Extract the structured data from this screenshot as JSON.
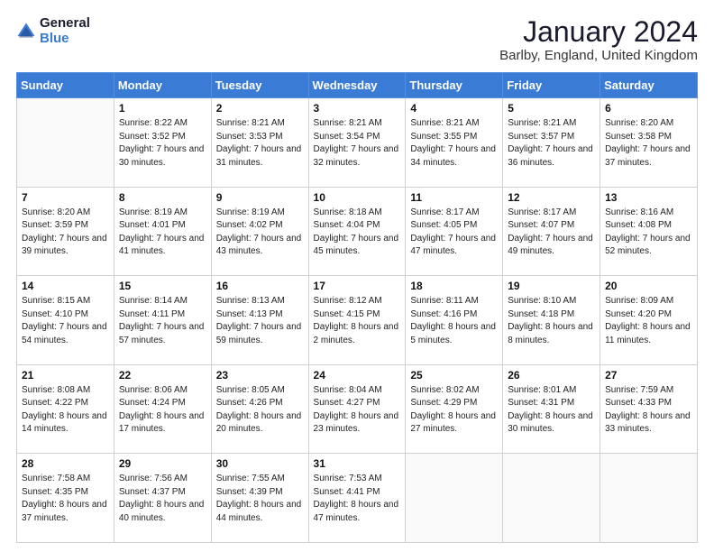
{
  "header": {
    "logo_general": "General",
    "logo_blue": "Blue",
    "month_title": "January 2024",
    "location": "Barlby, England, United Kingdom"
  },
  "days_of_week": [
    "Sunday",
    "Monday",
    "Tuesday",
    "Wednesday",
    "Thursday",
    "Friday",
    "Saturday"
  ],
  "weeks": [
    [
      {
        "date": "",
        "sunrise": "",
        "sunset": "",
        "daylight": ""
      },
      {
        "date": "1",
        "sunrise": "Sunrise: 8:22 AM",
        "sunset": "Sunset: 3:52 PM",
        "daylight": "Daylight: 7 hours and 30 minutes."
      },
      {
        "date": "2",
        "sunrise": "Sunrise: 8:21 AM",
        "sunset": "Sunset: 3:53 PM",
        "daylight": "Daylight: 7 hours and 31 minutes."
      },
      {
        "date": "3",
        "sunrise": "Sunrise: 8:21 AM",
        "sunset": "Sunset: 3:54 PM",
        "daylight": "Daylight: 7 hours and 32 minutes."
      },
      {
        "date": "4",
        "sunrise": "Sunrise: 8:21 AM",
        "sunset": "Sunset: 3:55 PM",
        "daylight": "Daylight: 7 hours and 34 minutes."
      },
      {
        "date": "5",
        "sunrise": "Sunrise: 8:21 AM",
        "sunset": "Sunset: 3:57 PM",
        "daylight": "Daylight: 7 hours and 36 minutes."
      },
      {
        "date": "6",
        "sunrise": "Sunrise: 8:20 AM",
        "sunset": "Sunset: 3:58 PM",
        "daylight": "Daylight: 7 hours and 37 minutes."
      }
    ],
    [
      {
        "date": "7",
        "sunrise": "Sunrise: 8:20 AM",
        "sunset": "Sunset: 3:59 PM",
        "daylight": "Daylight: 7 hours and 39 minutes."
      },
      {
        "date": "8",
        "sunrise": "Sunrise: 8:19 AM",
        "sunset": "Sunset: 4:01 PM",
        "daylight": "Daylight: 7 hours and 41 minutes."
      },
      {
        "date": "9",
        "sunrise": "Sunrise: 8:19 AM",
        "sunset": "Sunset: 4:02 PM",
        "daylight": "Daylight: 7 hours and 43 minutes."
      },
      {
        "date": "10",
        "sunrise": "Sunrise: 8:18 AM",
        "sunset": "Sunset: 4:04 PM",
        "daylight": "Daylight: 7 hours and 45 minutes."
      },
      {
        "date": "11",
        "sunrise": "Sunrise: 8:17 AM",
        "sunset": "Sunset: 4:05 PM",
        "daylight": "Daylight: 7 hours and 47 minutes."
      },
      {
        "date": "12",
        "sunrise": "Sunrise: 8:17 AM",
        "sunset": "Sunset: 4:07 PM",
        "daylight": "Daylight: 7 hours and 49 minutes."
      },
      {
        "date": "13",
        "sunrise": "Sunrise: 8:16 AM",
        "sunset": "Sunset: 4:08 PM",
        "daylight": "Daylight: 7 hours and 52 minutes."
      }
    ],
    [
      {
        "date": "14",
        "sunrise": "Sunrise: 8:15 AM",
        "sunset": "Sunset: 4:10 PM",
        "daylight": "Daylight: 7 hours and 54 minutes."
      },
      {
        "date": "15",
        "sunrise": "Sunrise: 8:14 AM",
        "sunset": "Sunset: 4:11 PM",
        "daylight": "Daylight: 7 hours and 57 minutes."
      },
      {
        "date": "16",
        "sunrise": "Sunrise: 8:13 AM",
        "sunset": "Sunset: 4:13 PM",
        "daylight": "Daylight: 7 hours and 59 minutes."
      },
      {
        "date": "17",
        "sunrise": "Sunrise: 8:12 AM",
        "sunset": "Sunset: 4:15 PM",
        "daylight": "Daylight: 8 hours and 2 minutes."
      },
      {
        "date": "18",
        "sunrise": "Sunrise: 8:11 AM",
        "sunset": "Sunset: 4:16 PM",
        "daylight": "Daylight: 8 hours and 5 minutes."
      },
      {
        "date": "19",
        "sunrise": "Sunrise: 8:10 AM",
        "sunset": "Sunset: 4:18 PM",
        "daylight": "Daylight: 8 hours and 8 minutes."
      },
      {
        "date": "20",
        "sunrise": "Sunrise: 8:09 AM",
        "sunset": "Sunset: 4:20 PM",
        "daylight": "Daylight: 8 hours and 11 minutes."
      }
    ],
    [
      {
        "date": "21",
        "sunrise": "Sunrise: 8:08 AM",
        "sunset": "Sunset: 4:22 PM",
        "daylight": "Daylight: 8 hours and 14 minutes."
      },
      {
        "date": "22",
        "sunrise": "Sunrise: 8:06 AM",
        "sunset": "Sunset: 4:24 PM",
        "daylight": "Daylight: 8 hours and 17 minutes."
      },
      {
        "date": "23",
        "sunrise": "Sunrise: 8:05 AM",
        "sunset": "Sunset: 4:26 PM",
        "daylight": "Daylight: 8 hours and 20 minutes."
      },
      {
        "date": "24",
        "sunrise": "Sunrise: 8:04 AM",
        "sunset": "Sunset: 4:27 PM",
        "daylight": "Daylight: 8 hours and 23 minutes."
      },
      {
        "date": "25",
        "sunrise": "Sunrise: 8:02 AM",
        "sunset": "Sunset: 4:29 PM",
        "daylight": "Daylight: 8 hours and 27 minutes."
      },
      {
        "date": "26",
        "sunrise": "Sunrise: 8:01 AM",
        "sunset": "Sunset: 4:31 PM",
        "daylight": "Daylight: 8 hours and 30 minutes."
      },
      {
        "date": "27",
        "sunrise": "Sunrise: 7:59 AM",
        "sunset": "Sunset: 4:33 PM",
        "daylight": "Daylight: 8 hours and 33 minutes."
      }
    ],
    [
      {
        "date": "28",
        "sunrise": "Sunrise: 7:58 AM",
        "sunset": "Sunset: 4:35 PM",
        "daylight": "Daylight: 8 hours and 37 minutes."
      },
      {
        "date": "29",
        "sunrise": "Sunrise: 7:56 AM",
        "sunset": "Sunset: 4:37 PM",
        "daylight": "Daylight: 8 hours and 40 minutes."
      },
      {
        "date": "30",
        "sunrise": "Sunrise: 7:55 AM",
        "sunset": "Sunset: 4:39 PM",
        "daylight": "Daylight: 8 hours and 44 minutes."
      },
      {
        "date": "31",
        "sunrise": "Sunrise: 7:53 AM",
        "sunset": "Sunset: 4:41 PM",
        "daylight": "Daylight: 8 hours and 47 minutes."
      },
      {
        "date": "",
        "sunrise": "",
        "sunset": "",
        "daylight": ""
      },
      {
        "date": "",
        "sunrise": "",
        "sunset": "",
        "daylight": ""
      },
      {
        "date": "",
        "sunrise": "",
        "sunset": "",
        "daylight": ""
      }
    ]
  ]
}
